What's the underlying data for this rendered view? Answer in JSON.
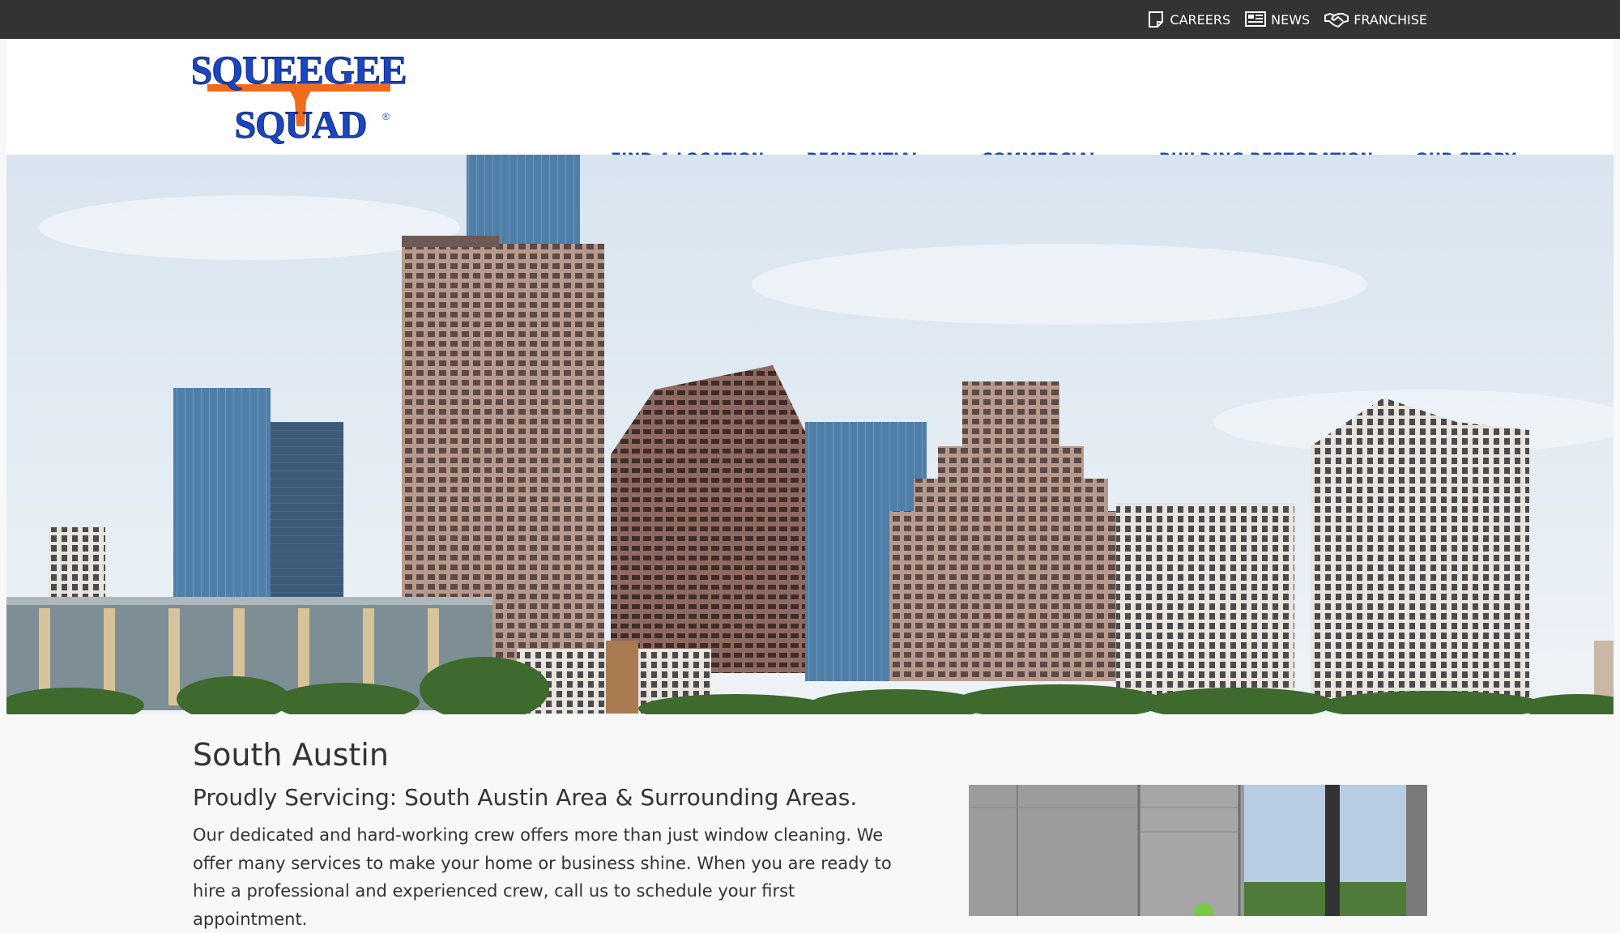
{
  "utility_nav": {
    "careers": {
      "label": "CAREERS",
      "icon": "document-icon"
    },
    "news": {
      "label": "NEWS",
      "icon": "newspaper-icon"
    },
    "franchise": {
      "label": "FRANCHISE",
      "icon": "handshake-icon"
    }
  },
  "logo": {
    "line1": "SQUEEGEE",
    "line2": "SQUAD",
    "registered": "®"
  },
  "main_nav": [
    {
      "label": "FIND A LOCATION",
      "has_dropdown": false
    },
    {
      "label": "RESIDENTIAL",
      "has_dropdown": true
    },
    {
      "label": "COMMERCIAL",
      "has_dropdown": true
    },
    {
      "label": "BUILDING RESTORATION",
      "has_dropdown": false
    },
    {
      "label": "OUR STORY",
      "has_dropdown": false
    }
  ],
  "content": {
    "title": "South Austin",
    "subtitle": "Proudly Servicing: South Austin Area & Surrounding Areas.",
    "body": "Our dedicated and hard-working crew offers more than just window cleaning. We offer many services to make your home or business shine. When you are ready to hire a professional and experienced crew, call us to schedule your first appointment."
  },
  "colors": {
    "topbar": "#333333",
    "nav_text": "#1a47b8",
    "logo_blue": "#1b46c2",
    "logo_orange": "#f26a1b",
    "body_text": "#333333"
  }
}
